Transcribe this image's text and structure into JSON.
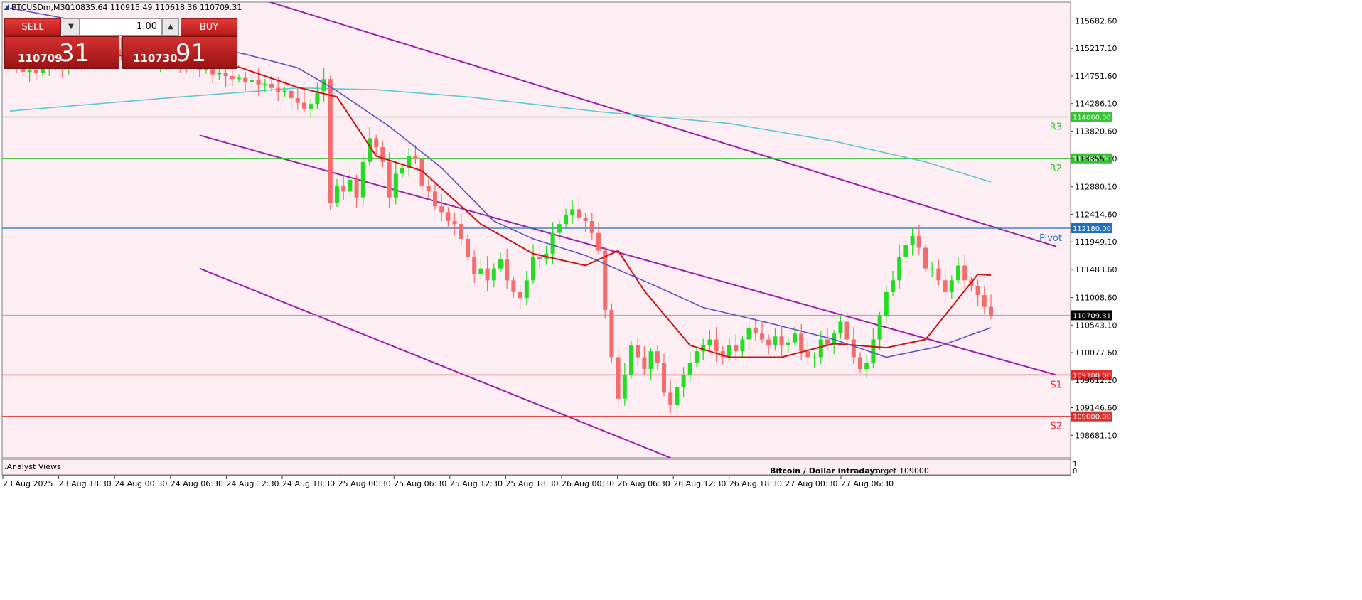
{
  "header": {
    "symbol_line": "BTCUSDm,M30",
    "ohlc": "110835.64 110915.49 110618.36 110709.31"
  },
  "trade_panel": {
    "sell_label": "SELL",
    "buy_label": "BUY",
    "lot_size": "1.00",
    "bid_small": "110709",
    "bid_big": "31",
    "ask_small": "110730",
    "ask_big": "91"
  },
  "indicator_window_label": ".Analyst Views",
  "colors": {
    "background": "#fdeef4",
    "bull": "#22dd22",
    "bear": "#f26d6d",
    "resistance": "#36c236",
    "pivot": "#1e6fc4",
    "support": "#e03030",
    "channel": "#9b1fa8",
    "fast_ma": "#cc1414",
    "mid_ma": "#5a52c2",
    "slow_ma": "#5cc8cf"
  },
  "chart_data": {
    "type": "candlestick",
    "symbol": "BTCUSDm",
    "timeframe": "M30",
    "ylim": [
      108300,
      116000
    ],
    "y_ticks": [
      "115682.60",
      "115217.10",
      "114751.60",
      "114286.10",
      "113820.60",
      "113355.10",
      "112880.10",
      "112414.60",
      "111949.10",
      "111483.60",
      "111008.60",
      "110543.10",
      "110077.60",
      "109612.10",
      "109146.60",
      "108681.10"
    ],
    "x_ticks": [
      "23 Aug 2025",
      "23 Aug 18:30",
      "24 Aug 00:30",
      "24 Aug 06:30",
      "24 Aug 12:30",
      "24 Aug 18:30",
      "25 Aug 00:30",
      "25 Aug 06:30",
      "25 Aug 12:30",
      "25 Aug 18:30",
      "26 Aug 00:30",
      "26 Aug 06:30",
      "26 Aug 12:30",
      "26 Aug 18:30",
      "27 Aug 00:30",
      "27 Aug 06:30"
    ],
    "current_price": {
      "value": 110709.31,
      "label": "110709.31"
    },
    "levels": [
      {
        "name": "R3",
        "value": 114060,
        "label": "114060.00",
        "kind": "resistance"
      },
      {
        "name": "R2",
        "value": 113360,
        "label": "113360.00",
        "kind": "resistance"
      },
      {
        "name": "Pivot",
        "value": 112180,
        "label": "112180.00",
        "kind": "pivot"
      },
      {
        "name": "S1",
        "value": 109700,
        "label": "109700.00",
        "kind": "support"
      },
      {
        "name": "S2",
        "value": 109000,
        "label": "109000.00",
        "kind": "support"
      }
    ],
    "series": [
      {
        "close": [
          115000,
          114950,
          114820,
          114860,
          114800,
          114900,
          114950,
          115020,
          114900,
          114930,
          115000,
          114980,
          115050,
          115000,
          115100,
          115050,
          115200,
          115100,
          115080,
          115150,
          115100,
          115120,
          115000,
          115050,
          114980,
          115020,
          114960,
          114900,
          114920,
          114850,
          114880,
          114780,
          114800,
          114750,
          114700,
          114720,
          114650,
          114680,
          114600,
          114620,
          114550,
          114480,
          114500,
          114380,
          114300,
          114200,
          114280,
          114500,
          114700,
          112600,
          112900,
          112800,
          113000,
          112700,
          113300,
          113700,
          113550,
          113300,
          112700,
          113100,
          113200,
          113400,
          113350,
          112900,
          112800,
          112550,
          112450,
          112300,
          112250,
          112000,
          111700,
          111400,
          111500,
          111300,
          111500,
          111650,
          111300,
          111100,
          111000,
          111300,
          111700,
          111650,
          111750,
          112100,
          112250,
          112400,
          112500,
          112350,
          112300,
          112100,
          111800,
          110800,
          110000,
          109300,
          109700,
          110200,
          110000,
          109800,
          110100,
          109900,
          109400,
          109200,
          109500,
          109700,
          109900,
          110100,
          110200,
          110300,
          110100,
          110000,
          110200,
          110100,
          110300,
          110500,
          110400,
          110300,
          110200,
          110350,
          110200,
          110250,
          110400,
          110100,
          110000,
          110000,
          110300,
          110200,
          110400,
          110600,
          110300,
          110000,
          109800,
          109900,
          110300,
          110700,
          111100,
          111300,
          111700,
          111900,
          112050,
          111850,
          111500,
          111500,
          111300,
          111100,
          111300,
          111550,
          111300,
          111200,
          111050,
          110850,
          110700
        ]
      }
    ],
    "moving_averages": [
      {
        "role": "fast",
        "points": [
          [
            0,
            115080
          ],
          [
            20,
            115100
          ],
          [
            33,
            114980
          ],
          [
            44,
            114560
          ],
          [
            50,
            114400
          ],
          [
            56,
            113400
          ],
          [
            63,
            113150
          ],
          [
            72,
            112250
          ],
          [
            80,
            111750
          ],
          [
            88,
            111550
          ],
          [
            93,
            111800
          ],
          [
            97,
            111120
          ],
          [
            104,
            110200
          ],
          [
            110,
            110000
          ],
          [
            118,
            110000
          ],
          [
            126,
            110230
          ],
          [
            134,
            110160
          ],
          [
            140,
            110300
          ],
          [
            148,
            111400
          ],
          [
            156,
            111350
          ],
          [
            160,
            111180
          ]
        ]
      },
      {
        "role": "mid",
        "points": [
          [
            0,
            115900
          ],
          [
            24,
            115400
          ],
          [
            36,
            115120
          ],
          [
            44,
            114890
          ],
          [
            50,
            114500
          ],
          [
            58,
            113900
          ],
          [
            66,
            113200
          ],
          [
            74,
            112300
          ],
          [
            80,
            112000
          ],
          [
            88,
            111720
          ],
          [
            98,
            111240
          ],
          [
            106,
            110840
          ],
          [
            116,
            110580
          ],
          [
            126,
            110300
          ],
          [
            134,
            110000
          ],
          [
            142,
            110180
          ],
          [
            150,
            110500
          ],
          [
            160,
            110700
          ]
        ]
      },
      {
        "role": "slow",
        "points": [
          [
            0,
            114160
          ],
          [
            24,
            114380
          ],
          [
            44,
            114550
          ],
          [
            56,
            114520
          ],
          [
            70,
            114400
          ],
          [
            90,
            114150
          ],
          [
            110,
            113950
          ],
          [
            126,
            113650
          ],
          [
            140,
            113300
          ],
          [
            150,
            112960
          ],
          [
            160,
            112600
          ]
        ]
      }
    ],
    "channel_lines": [
      {
        "from": [
          34,
          116200
        ],
        "to": [
          160,
          111870
        ]
      },
      {
        "from": [
          29,
          113750
        ],
        "to": [
          160,
          109700
        ]
      },
      {
        "from": [
          29,
          111500
        ],
        "to": [
          101,
          108300
        ]
      }
    ],
    "annotation": {
      "text": "Bitcoin / Dollar intraday:",
      "target": "target 109000"
    },
    "indicator_axis_ticks": [
      "1",
      "0"
    ]
  }
}
